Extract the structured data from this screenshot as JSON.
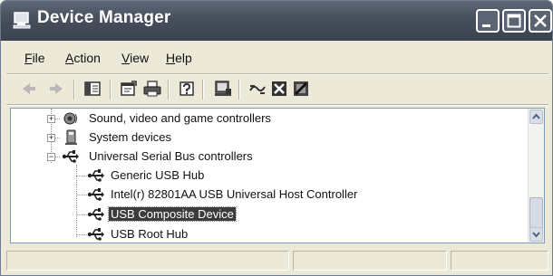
{
  "window": {
    "title": "Device Manager"
  },
  "menu": {
    "file": {
      "u": "F",
      "rest": "ile"
    },
    "action": {
      "u": "A",
      "rest": "ction"
    },
    "view": {
      "u": "V",
      "rest": "iew"
    },
    "help": {
      "u": "H",
      "rest": "elp"
    }
  },
  "toolbar": {
    "icons": [
      "back-icon",
      "forward-icon",
      "show-hide-tree-icon",
      "properties-icon",
      "print-icon",
      "help-icon",
      "update-driver-icon",
      "scan-hardware-icon",
      "uninstall-icon",
      "disable-icon"
    ]
  },
  "tree": {
    "items": [
      {
        "label": "Sound, video and game controllers",
        "expander": "+",
        "icon": "speaker-icon"
      },
      {
        "label": "System devices",
        "expander": "+",
        "icon": "system-device-icon"
      },
      {
        "label": "Universal Serial Bus controllers",
        "expander": "−",
        "icon": "usb-icon"
      }
    ],
    "children": [
      {
        "label": "Generic USB Hub",
        "icon": "usb-icon",
        "selected": false
      },
      {
        "label": "Intel(r) 82801AA USB Universal Host Controller",
        "icon": "usb-icon",
        "selected": false
      },
      {
        "label": "USB Composite Device",
        "icon": "usb-icon",
        "selected": true
      },
      {
        "label": "USB Root Hub",
        "icon": "usb-icon",
        "selected": false
      }
    ]
  },
  "colors": {
    "titlebar": "#474f5c",
    "selection": "#3c3c3c",
    "chrome": "#ece9d8"
  }
}
